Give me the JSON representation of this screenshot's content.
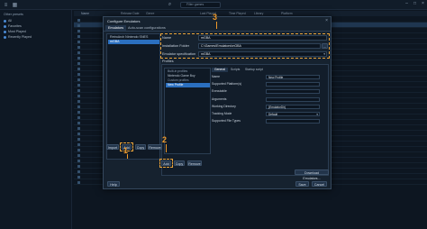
{
  "toolbar": {
    "filter_placeholder": "Filter games"
  },
  "sidebar": {
    "items": [
      {
        "label": "Other presets"
      },
      {
        "label": "All"
      },
      {
        "label": "Favorites"
      },
      {
        "label": "Most Played"
      },
      {
        "label": "Recently Played"
      }
    ]
  },
  "list": {
    "columns": [
      "Name",
      "Release Date",
      "Genre",
      "Last Played",
      "Time Played",
      "Library",
      "Platform"
    ]
  },
  "dialog": {
    "title": "Configure Emulators",
    "tabs": [
      "Emulators",
      "Auto-scan configurations"
    ],
    "emulators": [
      "RetroArch Nintendo SNES",
      "mGBA"
    ],
    "selected_emulator": "mGBA",
    "name_label": "Name",
    "name_value": "mGBA",
    "install_label": "Installation Folder",
    "install_value": "C:\\Games\\Emulators\\mGBA",
    "spec_label": "Emulator specification",
    "spec_value": "mGBA",
    "profiles_label": "Profiles",
    "builtin_header": "Built-in profiles",
    "builtin_profiles": [
      "Nintendo Game Boy"
    ],
    "custom_header": "Custom profiles",
    "custom_profiles": [
      "New Profile"
    ],
    "profile_tabs": [
      "General",
      "Scripts",
      "Startup script"
    ],
    "profile_fields": [
      {
        "label": "Name",
        "value": "New Profile"
      },
      {
        "label": "Supported Platform(s)",
        "value": ""
      },
      {
        "label": "Executable",
        "value": ""
      },
      {
        "label": "Arguments",
        "value": ""
      },
      {
        "label": "Working Directory",
        "value": "{EmulatorDir}"
      },
      {
        "label": "Tracking Mode",
        "value": "Default"
      },
      {
        "label": "Supported File Types",
        "value": ""
      }
    ],
    "buttons": {
      "import": "Import",
      "add": "Add",
      "copy": "Copy",
      "remove": "Remove",
      "profile_add": "Add",
      "profile_copy": "Copy",
      "profile_remove": "Remove",
      "download": "Download Emulators...",
      "help": "Help",
      "save": "Save",
      "cancel": "Cancel"
    }
  },
  "annotations": {
    "one": "1",
    "two": "2",
    "three": "3",
    "color": "#f09a2a"
  }
}
